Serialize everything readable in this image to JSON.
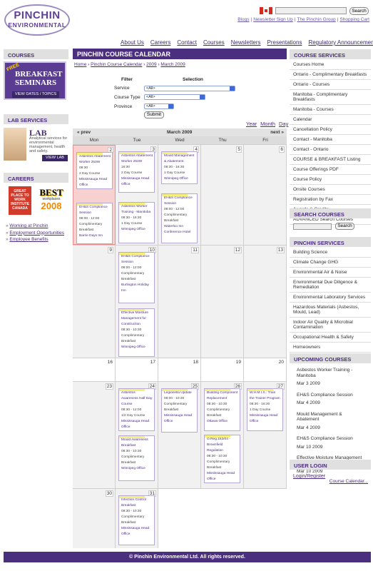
{
  "header": {
    "logo_top": "PINCHIN",
    "logo_bottom": "ENVIRONMENTAL",
    "search_button": "Search",
    "top_links": [
      "Blogs",
      "Newsletter Sign Up",
      "The Pinchin Group",
      "Shopping Cart"
    ]
  },
  "nav": [
    "About Us",
    "Careers",
    "Contact",
    "Courses",
    "Newsletters",
    "Presentations",
    "Regulatory Announcements"
  ],
  "left": {
    "courses_heading": "COURSES",
    "breakfast": {
      "free": "FREE",
      "line1": "BREAKFAST",
      "line2": "SEMINARS",
      "button": "VIEW DATES / TOPICS"
    },
    "lab_heading": "LAB SERVICES",
    "lab": {
      "title": "LAB",
      "desc": "Analytical services for environmental management, health and safety.",
      "button": "VIEW LAB"
    },
    "careers_heading": "CAREERS",
    "gptw": "GREAT PLACE TO WORK INSTITUTE CANADA",
    "best": {
      "best": "BEST",
      "workplaces": "workplaces",
      "year": "2008"
    },
    "career_links": [
      "Working at Pinchin",
      "Employment Opportunities",
      "Employee Benefits"
    ]
  },
  "main": {
    "title": "PINCHIN COURSE CALENDAR",
    "breadcrumb": [
      "Home",
      "Pinchin Course Calendar",
      "2009",
      "March 2009"
    ],
    "filter": {
      "h1": "Filter",
      "h2": "Selection",
      "rows": [
        {
          "label": "Service",
          "value": "<All>"
        },
        {
          "label": "Course Type",
          "value": "<All>"
        },
        {
          "label": "Province",
          "value": "<All>"
        }
      ],
      "submit": "Submit"
    },
    "views": [
      "Year",
      "Month",
      "Day"
    ],
    "calendar": {
      "prev": "« prev",
      "month": "March 2009",
      "next": "next »",
      "days": [
        "Mon",
        "Tue",
        "Wed",
        "Thu",
        "Fri"
      ],
      "weeks": [
        {
          "nums": [
            "2",
            "3",
            "4",
            "5",
            "6"
          ],
          "today": 0
        },
        {
          "nums": [
            "9",
            "10",
            "11",
            "12",
            "13"
          ]
        },
        {
          "nums": [
            "16",
            "17",
            "18",
            "19",
            "20"
          ]
        },
        {
          "nums": [
            "23",
            "24",
            "25",
            "26",
            "27"
          ]
        },
        {
          "nums": [
            "30",
            "31"
          ]
        }
      ],
      "events": [
        {
          "lines": [
            "Asbestos Abatement Worker 253W",
            "08:30",
            "2 Day Course",
            "Mississauga Head Office"
          ]
        },
        {
          "lines": [
            "EH&S Compliance Session",
            "08:00 - 12:00",
            "Complimentary Breakfast",
            "Barrie Days Inn"
          ]
        },
        {
          "lines": [
            "Asbestos Abatement Worker 253W",
            "16:30",
            "2 Day Course",
            "Mississauga Head Office"
          ]
        },
        {
          "lines": [
            "Asbestos Worker Training - Manitoba",
            "08:30 - 16:30",
            "1 Day Course",
            "Winnipeg Office"
          ]
        },
        {
          "lines": [
            "Mould Management & Abatement",
            "08:30 - 16:30",
            "1 Day Course",
            "Winnipeg Office"
          ]
        },
        {
          "lines": [
            "EH&S Compliance Session",
            "08:00 - 12:00",
            "Complimentary Breakfast",
            "Waterloo Inn Conference Hotel"
          ]
        },
        {
          "lines": [
            "EH&S Compliance Session",
            "08:00 - 12:00",
            "Complimentary Breakfast",
            "Burlington Holiday Inn"
          ]
        },
        {
          "lines": [
            "Effective Moisture Management for Construction",
            "08:30 - 10:30",
            "Complimentary Breakfast",
            "Winnipeg Office"
          ]
        },
        {
          "lines": [
            "Asbestos Awareness Half Day Course",
            "08:30 - 12:00",
            "1/2 Day Course",
            "Mississauga Head Office"
          ]
        },
        {
          "lines": [
            "Mould Awareness Breakfast",
            "08:30 - 10:30",
            "Complimentary Breakfast",
            "Winnipeg Office"
          ]
        },
        {
          "lines": [
            "Legionella Update",
            "08:00 - 10:30",
            "Complimentary Breakfast",
            "Mississauga Head Office"
          ]
        },
        {
          "lines": [
            "Building Component Replacement",
            "08:30 - 10:30",
            "Complimentary Breakfast",
            "Ottawa Office"
          ]
        },
        {
          "lines": [
            "O.Reg.153/04 - Brownfield Regulation",
            "08:30 - 10:30",
            "Complimentary Breakfast",
            "Mississauga Head Office"
          ]
        },
        {
          "lines": [
            "W.H.M.I.S.: Train the Trainer Program",
            "08:30 - 16:30",
            "1 Day Course",
            "Mississauga Head Office"
          ]
        },
        {
          "lines": [
            "Infection Control Breakfast",
            "08:30 - 10:30",
            "Complimentary Breakfast",
            "Mississauga Head Office"
          ]
        }
      ]
    }
  },
  "right": {
    "course_services_heading": "COURSE SERVICES",
    "course_services": [
      "Courses Home",
      "Ontario - Complimentary Breakfasts",
      "Ontario - Courses",
      "Manitoba - Complimentary Breakfasts",
      "Manitoba - Courses",
      "Calendar",
      "Cancellation Policy",
      "Contact - Manitoba",
      "Contact - Ontario",
      "COURSE & BREAKFAST Listing",
      "Course Offerings PDF",
      "Course Policy",
      "Onsite Courses",
      "Registration by Fax",
      "Awards & Credits",
      "ADVANCED Search Courses"
    ],
    "search_heading": "SEARCH COURSES",
    "search_button": "Search",
    "pinchin_heading": "PINCHIN SERVICES",
    "pinchin_services": [
      "Building Science",
      "Climate Change GHG",
      "Environmental Air & Noise",
      "Environmental Due Diligence & Remediation",
      "Environmental Laboratory Services",
      "Hazardous Materials (Asbestos, Mould, Lead)",
      "Indoor Air Quality & Microbial Contamination",
      "Occupational Health & Safety",
      "Homeowners"
    ],
    "upcoming_heading": "UPCOMING COURSES",
    "upcoming": [
      {
        "title": "Asbestos Worker Training - Manitoba",
        "date": "Mar 3 2009"
      },
      {
        "title": "EH&S Compliance Session",
        "date": "Mar 4 2009"
      },
      {
        "title": "Mould Management & Abatement",
        "date": "Mar 4 2009"
      },
      {
        "title": "EH&S Compliance Session",
        "date": "Mar 10 2009"
      },
      {
        "title": "Effective Moisture Management for Construction",
        "date": "Mar 10 2009"
      }
    ],
    "more": "Course Calendar...",
    "login_heading": "USER LOGIN",
    "login_link": "Login/Register"
  },
  "footer": "© Pinchin Environmental Ltd. All rights reserved."
}
